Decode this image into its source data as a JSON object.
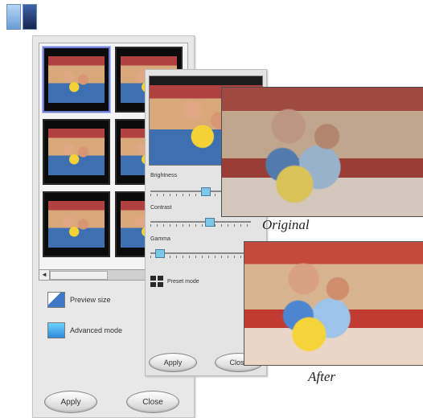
{
  "main_panel": {
    "preview_size_label": "Preview size",
    "advanced_mode_label": "Advanced mode",
    "apply_label": "Apply",
    "close_label": "Close",
    "scroll_arrow": "◄"
  },
  "advanced_panel": {
    "sliders": [
      {
        "label": "Brightness",
        "value": 0.55
      },
      {
        "label": "Contrast",
        "value": 0.6
      },
      {
        "label": "Gamma",
        "value": 0.05
      }
    ],
    "preset_label": "Preset mode",
    "apply_label": "Apply",
    "close_label": "Close"
  },
  "comparison": {
    "original_caption": "Original",
    "after_caption": "After"
  },
  "colors": {
    "selection_border": "#6f7fcf",
    "slider_knob": "#7ac7e8",
    "panel_bg": "#e8e8e8"
  }
}
